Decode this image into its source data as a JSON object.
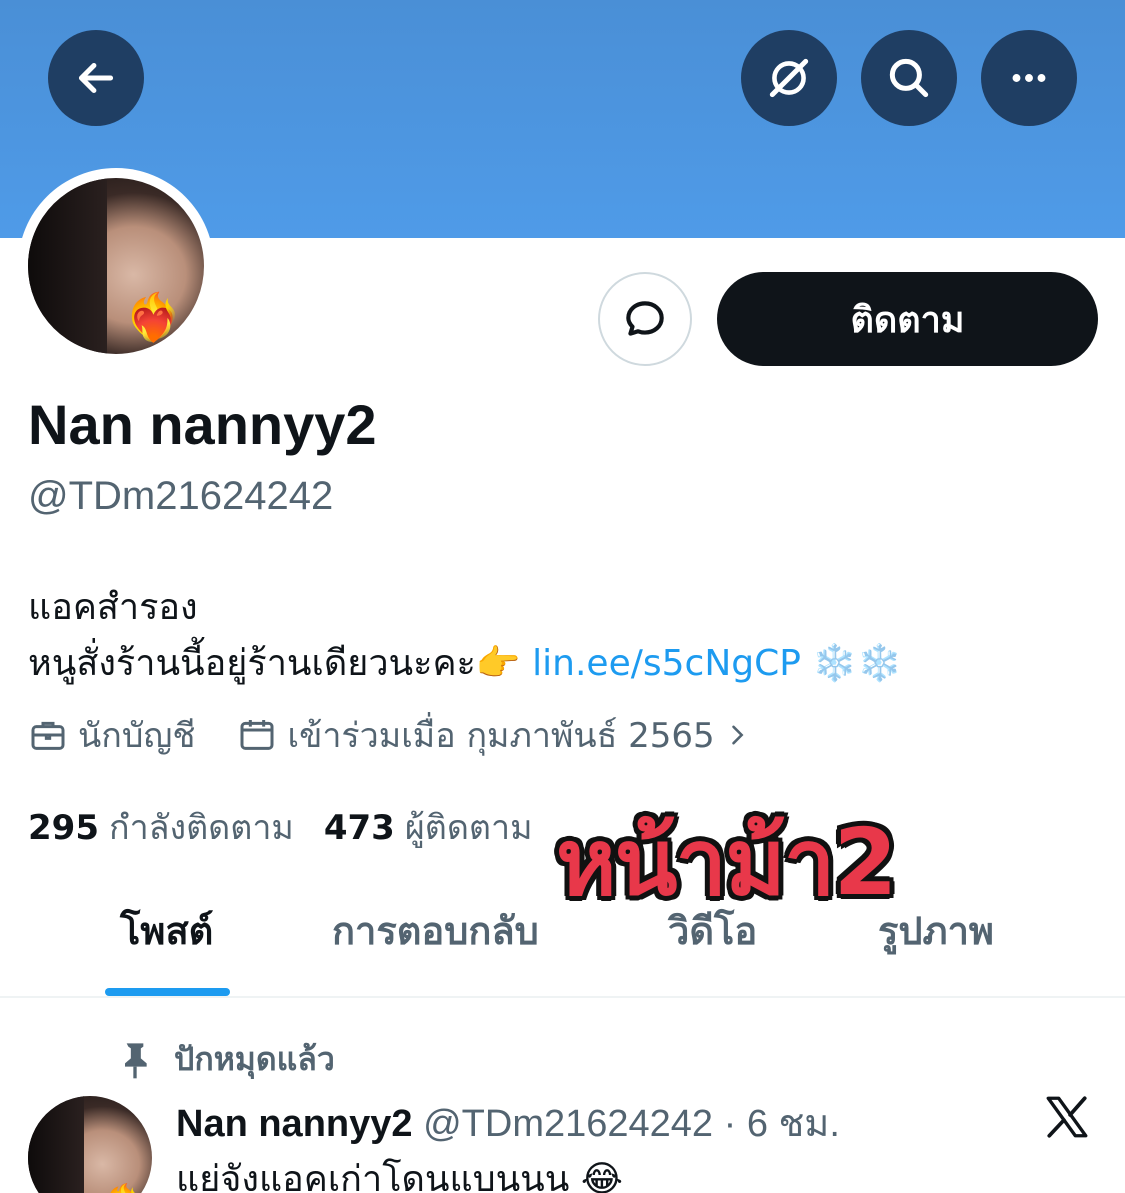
{
  "header": {
    "back_icon": "arrow-left-icon",
    "grok_icon": "grok-icon",
    "search_icon": "search-icon",
    "more_icon": "more-horizontal-icon",
    "banner_color": "#4f9be8"
  },
  "profile": {
    "avatar_badge": "❤️‍🔥",
    "message_icon": "message-bubble-icon",
    "follow_label": "ติดตาม",
    "display_name": "Nan nannyy2",
    "handle": "@TDm21624242",
    "bio_line1": "แอคสำรอง",
    "bio_line2": "หนูสั่งร้านนี้อยู่ร้านเดียวนะคะ👉 ",
    "bio_link": "lin.ee/s5cNgCP",
    "bio_suffix": " ❄️❄️",
    "profession": "นักบัญชี",
    "joined": "เข้าร่วมเมื่อ กุมภาพันธ์ 2565",
    "following_count": "295",
    "following_label": "กำลังติดตาม",
    "followers_count": "473",
    "followers_label": "ผู้ติดตาม"
  },
  "overlay": {
    "text": "หน้าม้า2",
    "color": "#e8384a"
  },
  "tabs": [
    {
      "label": "โพสต์",
      "active": true
    },
    {
      "label": "การตอบกลับ",
      "active": false
    },
    {
      "label": "วิดีโอ",
      "active": false
    },
    {
      "label": "รูปภาพ",
      "active": false
    }
  ],
  "post": {
    "pinned_label": "ปักหมุดแล้ว",
    "author_name": "Nan nannyy2",
    "author_handle_time": " @TDm21624242 · 6 ชม.",
    "text": "แย่จังแอคเก่าโดนแบนนน 😂",
    "avatar_badge": "❤️‍🔥",
    "platform_icon": "x-logo-icon"
  },
  "colors": {
    "accent": "#1d9bf0",
    "text_primary": "#0f1419",
    "text_secondary": "#536471",
    "button_dark": "#1f3e63"
  }
}
